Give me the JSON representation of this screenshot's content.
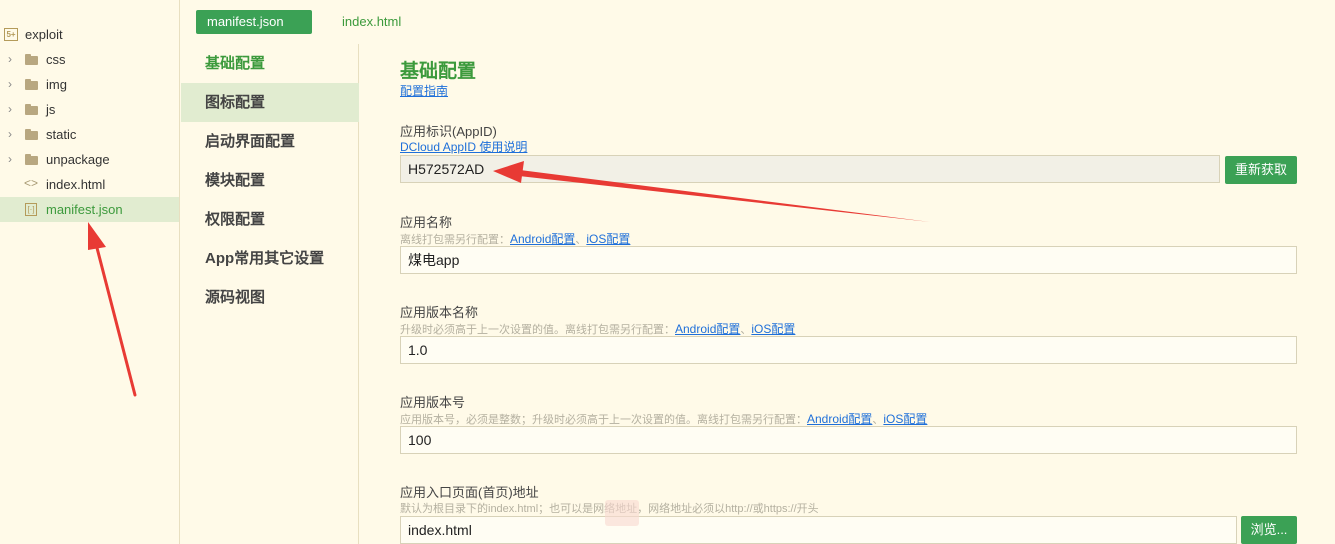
{
  "tree": {
    "root": "exploit",
    "root_icon": "5+",
    "items": [
      {
        "label": "css",
        "type": "folder"
      },
      {
        "label": "img",
        "type": "folder"
      },
      {
        "label": "js",
        "type": "folder"
      },
      {
        "label": "static",
        "type": "folder"
      },
      {
        "label": "unpackage",
        "type": "folder"
      },
      {
        "label": "index.html",
        "type": "html"
      },
      {
        "label": "manifest.json",
        "type": "json",
        "selected": true
      }
    ]
  },
  "tabs": [
    {
      "label": "manifest.json",
      "active": true
    },
    {
      "label": "index.html",
      "active": false
    }
  ],
  "nav": {
    "items": [
      "基础配置",
      "图标配置",
      "启动界面配置",
      "模块配置",
      "权限配置",
      "App常用其它设置",
      "源码视图"
    ]
  },
  "main": {
    "title": "基础配置",
    "guide_link": "配置指南",
    "appid": {
      "label": "应用标识(AppID)",
      "hint_link": "DCloud AppID 使用说明",
      "value": "H572572AD",
      "button": "重新获取"
    },
    "app_name": {
      "label": "应用名称",
      "hint": "离线打包需另行配置：",
      "android_link": "Android配置",
      "sep": "、",
      "ios_link": "iOS配置",
      "value": "煤电app"
    },
    "version_name": {
      "label": "应用版本名称",
      "hint": "升级时必须高于上一次设置的值。离线打包需另行配置：",
      "android_link": "Android配置",
      "sep": "、",
      "ios_link": "iOS配置",
      "value": "1.0"
    },
    "version_code": {
      "label": "应用版本号",
      "hint": "应用版本号，必须是整数；升级时必须高于上一次设置的值。离线打包需另行配置：",
      "android_link": "Android配置",
      "sep": "、",
      "ios_link": "iOS配置",
      "value": "100"
    },
    "entry": {
      "label": "应用入口页面(首页)地址",
      "hint": "默认为根目录下的index.html；也可以是网络地址，网络地址必须以http://或https://开头",
      "value": "index.html",
      "button": "浏览..."
    }
  },
  "colors": {
    "accent": "#3ba155",
    "background": "#fffae8",
    "selected_row": "#e1ecd0",
    "link": "#1e6fd9",
    "annotation_arrow": "#e83a34"
  }
}
